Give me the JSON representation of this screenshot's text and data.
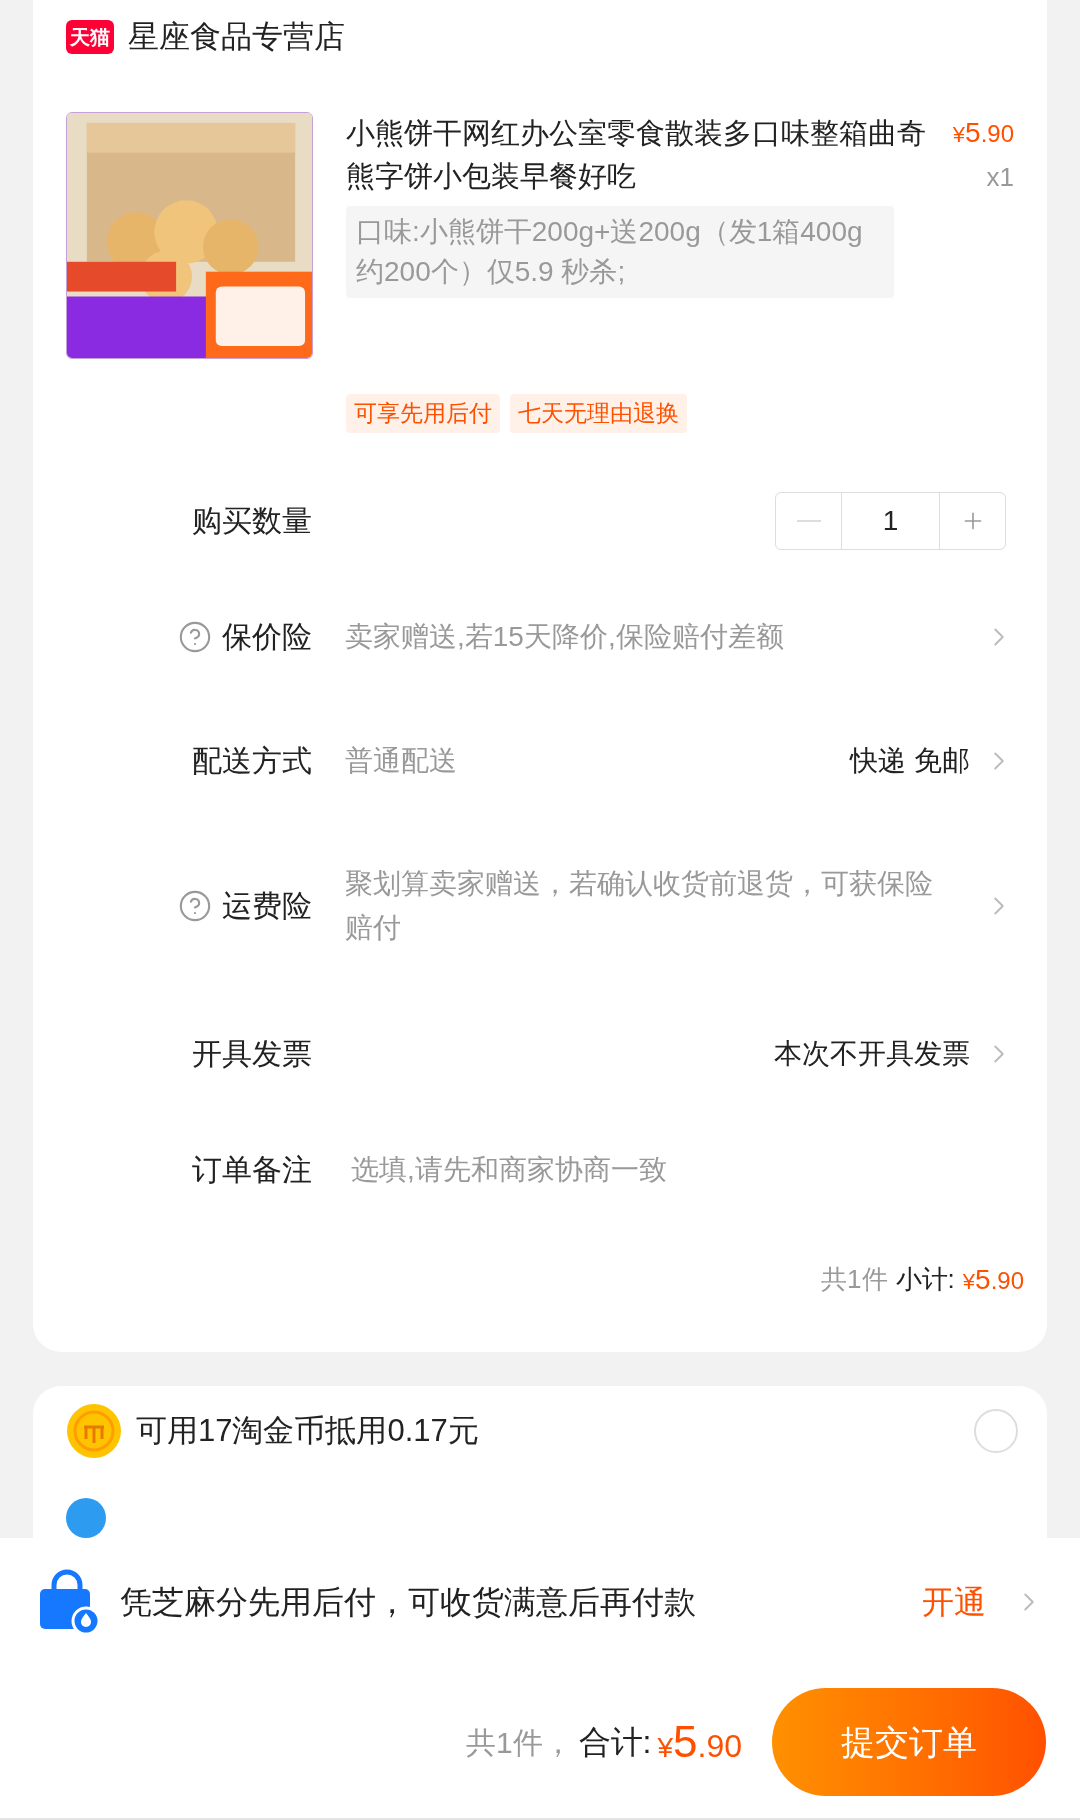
{
  "store": {
    "badge": "天猫",
    "name": "星座食品专营店"
  },
  "product": {
    "title": "小熊饼干网红办公室零食散装多口味整箱曲奇熊字饼小包装早餐好吃",
    "price": {
      "symbol": "¥",
      "int": "5",
      "dec": ".90"
    },
    "quantity": "x1",
    "spec": "口味:小熊饼干200g+送200g（发1箱400g约200个）仅5.9 秒杀;",
    "tags": [
      "可享先用后付",
      "七天无理由退换"
    ]
  },
  "rows": [
    {
      "kind": "stepper",
      "label": "购买数量",
      "value": "1",
      "minus_disabled": true
    },
    {
      "kind": "link",
      "help": true,
      "label": "保价险",
      "value": "卖家赠送,若15天降价,保险赔付差额"
    },
    {
      "kind": "link",
      "help": false,
      "label": "配送方式",
      "value": "普通配送",
      "detail": "快递 免邮"
    },
    {
      "kind": "link",
      "help": true,
      "label": "运费险",
      "value": "聚划算卖家赠送，若确认收货前退货，可获保险赔付"
    },
    {
      "kind": "link",
      "help": false,
      "label": "开具发票",
      "detail": "本次不开具发票"
    },
    {
      "kind": "input",
      "label": "订单备注",
      "placeholder": "选填,请先和商家协商一致"
    }
  ],
  "subtotal": {
    "count": "共1件",
    "label": "小计:",
    "price": {
      "symbol": "¥",
      "int": "5",
      "dec": ".90"
    }
  },
  "coins": {
    "text": "可用17淘金币抵用0.17元",
    "selected": false
  },
  "banner": {
    "text": "凭芝麻分先用后付，可收货满意后再付款",
    "action": "开通"
  },
  "footer": {
    "count": "共1件，",
    "label": "合计:",
    "price": {
      "symbol": "¥",
      "int": "5",
      "dec": ".90"
    },
    "button": "提交订单"
  }
}
